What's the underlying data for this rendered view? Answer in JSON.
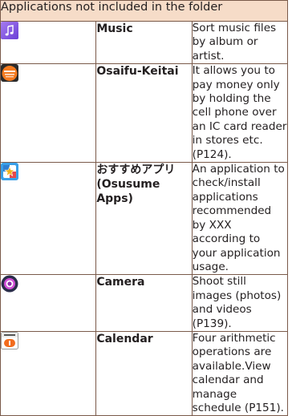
{
  "table": {
    "header": "Applications not included in the folder",
    "rows": [
      {
        "icon": "music-note-icon",
        "name": "Music",
        "description": "Sort music files by album or artist."
      },
      {
        "icon": "osaifu-keitai-icon",
        "name": "Osaifu-Keitai",
        "description": "It allows you to pay money only by holding the cell phone over an IC card reader in stores etc. (P124)."
      },
      {
        "icon": "recommended-apps-star-icon",
        "name": "おすすめアプリ(Osusume Apps)",
        "description": "An application to check/install applications recommended by XXX according to your application usage."
      },
      {
        "icon": "camera-icon",
        "name": "Camera",
        "description": "Shoot still images (photos) and videos (P139)."
      },
      {
        "icon": "calendar-icon",
        "name": "Calendar",
        "description": "Four arithmetic operations are available.View calendar and manage schedule (P151)."
      }
    ]
  },
  "colors": {
    "header_bg": "#f6dcc8",
    "border": "#7a5a4a",
    "text": "#231f20"
  }
}
